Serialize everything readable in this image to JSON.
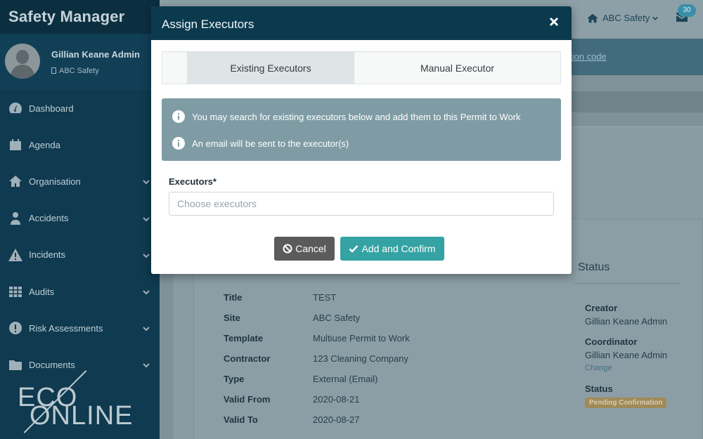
{
  "app": {
    "brand": "Safety Manager"
  },
  "profile": {
    "name": "Gillian Keane Admin",
    "org": "ABC Safety"
  },
  "sidebar": {
    "items": [
      {
        "label": "Dashboard",
        "icon": "dashboard-icon",
        "has_children": false
      },
      {
        "label": "Agenda",
        "icon": "calendar-icon",
        "has_children": false
      },
      {
        "label": "Organisation",
        "icon": "home-icon",
        "has_children": true
      },
      {
        "label": "Accidents",
        "icon": "injured-person-icon",
        "has_children": true
      },
      {
        "label": "Incidents",
        "icon": "warning-icon",
        "has_children": true
      },
      {
        "label": "Audits",
        "icon": "grid-icon",
        "has_children": true
      },
      {
        "label": "Risk Assessments",
        "icon": "alert-circle-icon",
        "has_children": true
      },
      {
        "label": "Documents",
        "icon": "folder-icon",
        "has_children": true
      }
    ],
    "logo": {
      "line1": "ECO",
      "line2": "ONLINE"
    }
  },
  "topbar": {
    "org_label": "ABC Safety",
    "mail_count": "30"
  },
  "alertbar": {
    "link_text": "tion code"
  },
  "details": {
    "rows": [
      {
        "label": "Title",
        "value": "TEST"
      },
      {
        "label": "Site",
        "value": "ABC Safety"
      },
      {
        "label": "Template",
        "value": "Multiuse Permit to Work"
      },
      {
        "label": "Contractor",
        "value": "123 Cleaning Company"
      },
      {
        "label": "Type",
        "value": "External (Email)"
      },
      {
        "label": "Valid From",
        "value": "2020-08-21"
      },
      {
        "label": "Valid To",
        "value": "2020-08-27"
      }
    ]
  },
  "status_panel": {
    "title": "Status",
    "creator_label": "Creator",
    "creator_value": "Gillian Keane Admin",
    "coordinator_label": "Coordinator",
    "coordinator_value": "Gillian Keane Admin",
    "change_link": "Change",
    "status_label": "Status",
    "status_badge": "Pending Confirmation"
  },
  "modal": {
    "title": "Assign Executors",
    "tabs": [
      {
        "label": "Existing Executors",
        "active": true
      },
      {
        "label": "Manual Executor",
        "active": false
      }
    ],
    "info": [
      "You may search for existing executors below and add them to this Permit to Work",
      "An email will be sent to the executor(s)"
    ],
    "field_label": "Executors*",
    "field_placeholder": "Choose executors",
    "field_value": "",
    "cancel_label": "Cancel",
    "confirm_label": "Add and Confirm"
  },
  "colors": {
    "sidebar_bg": "#0f3a50",
    "modal_header": "#0b3a4e",
    "info_bg": "#7f9ca5",
    "cancel_bg": "#5b5b5b",
    "confirm_bg": "#35a3a3"
  }
}
